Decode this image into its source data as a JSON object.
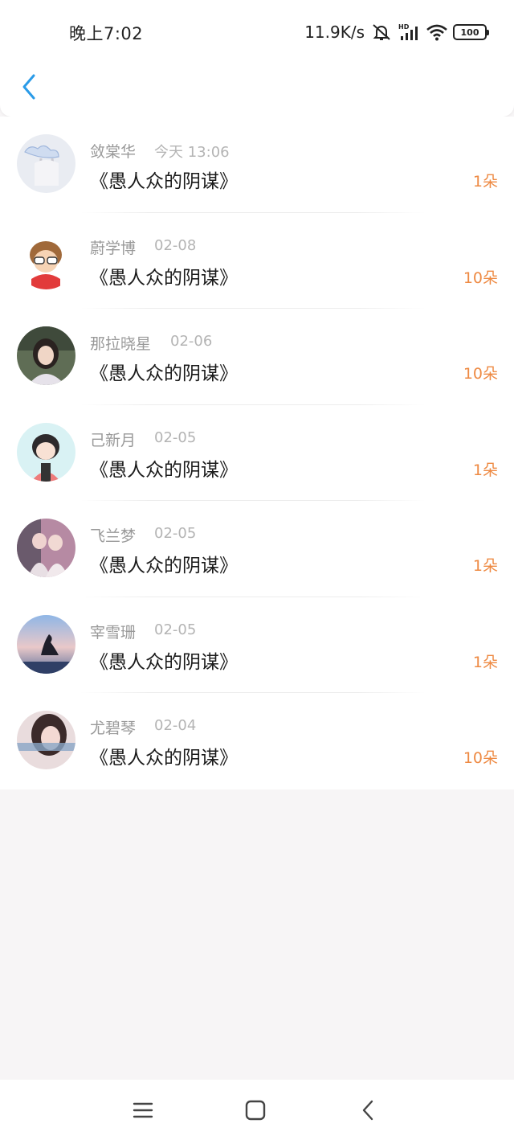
{
  "status_bar": {
    "time": "晚上7:02",
    "net_speed": "11.9K/s",
    "battery": "100"
  },
  "colors": {
    "accent_blue": "#2a9be8",
    "flower_orange": "#ee8a43",
    "name_gray": "#999999",
    "date_gray": "#b4b4b4"
  },
  "list": [
    {
      "name": "敛棠华",
      "date": "今天 13:06",
      "title": "《愚人众的阴谋》",
      "flowers": "1朵"
    },
    {
      "name": "蔚学博",
      "date": "02-08",
      "title": "《愚人众的阴谋》",
      "flowers": "10朵"
    },
    {
      "name": "那拉晓星",
      "date": "02-06",
      "title": "《愚人众的阴谋》",
      "flowers": "10朵"
    },
    {
      "name": "己新月",
      "date": "02-05",
      "title": "《愚人众的阴谋》",
      "flowers": "1朵"
    },
    {
      "name": "飞兰梦",
      "date": "02-05",
      "title": "《愚人众的阴谋》",
      "flowers": "1朵"
    },
    {
      "name": "宰雪珊",
      "date": "02-05",
      "title": "《愚人众的阴谋》",
      "flowers": "1朵"
    },
    {
      "name": "尤碧琴",
      "date": "02-04",
      "title": "《愚人众的阴谋》",
      "flowers": "10朵"
    }
  ],
  "icons": {
    "back": "chevron-left-icon",
    "nav_menu": "menu-icon",
    "nav_home": "home-square-icon",
    "nav_back": "back-chevron-icon"
  }
}
